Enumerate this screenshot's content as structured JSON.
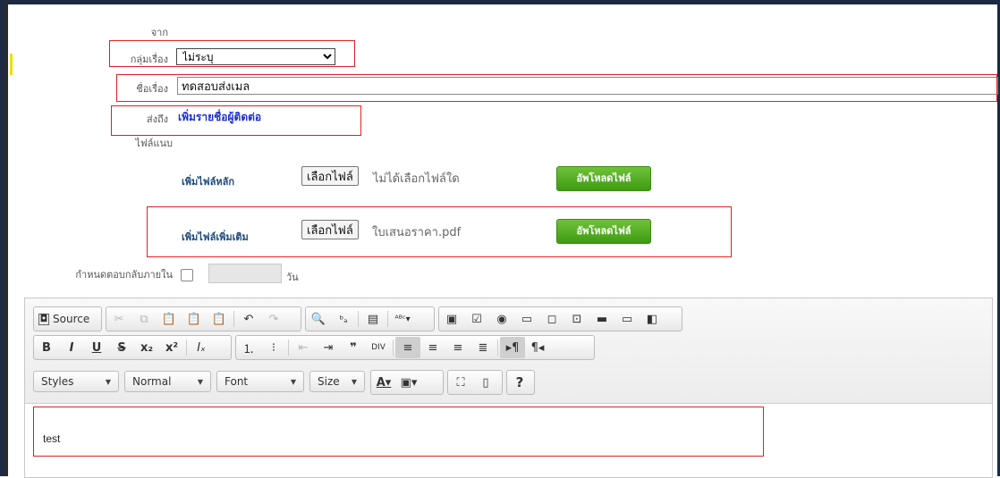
{
  "form": {
    "from_label": "จาก",
    "category_label": "กลุ่มเรื่อง",
    "category_value": "ไม่ระบุ",
    "subject_label": "ชื่อเรื่อง",
    "subject_value": "ทดสอบส่งเมล",
    "to_label": "ส่งถึง",
    "to_link": "เพิ่มรายชื่อผู้ติดต่อ",
    "attach_label": "ไฟล์แนบ"
  },
  "attachments": {
    "main_label": "เพิ่มไฟล์หลัก",
    "main_button": "เลือกไฟล์",
    "main_status": "ไม่ได้เลือกไฟล์ใด",
    "main_upload": "อัพโหลดไฟล์",
    "extra_label": "เพิ่มไฟล์เพิ่มเติม",
    "extra_button": "เลือกไฟล์",
    "extra_status": "ใบเสนอราคา.pdf",
    "extra_upload": "อัพโหลดไฟล์"
  },
  "deadline": {
    "label": "กำหนดตอบกลับภายใน",
    "unit": "วัน"
  },
  "editor": {
    "source_label": "Source",
    "styles": "Styles",
    "format": "Normal",
    "font": "Font",
    "size": "Size",
    "help": "?",
    "content": "test"
  },
  "colors": {
    "highlight_border": "#e02020",
    "link": "#1a2fd6",
    "upload_button": "#4aa81c"
  }
}
